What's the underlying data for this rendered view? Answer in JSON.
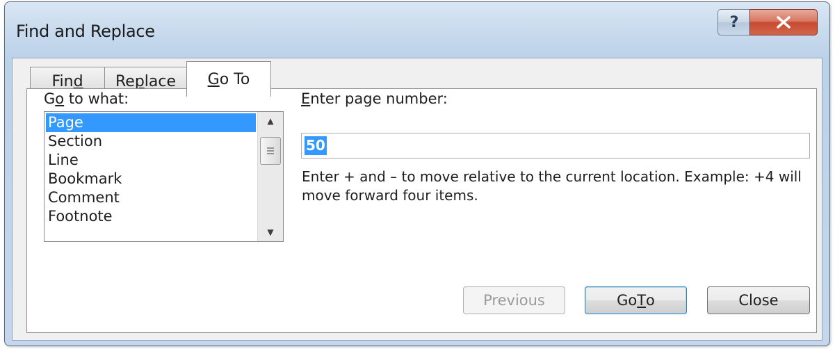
{
  "window": {
    "title": "Find and Replace"
  },
  "title_buttons": {
    "help_glyph": "?",
    "close_glyph": "✕"
  },
  "tabs": [
    {
      "label": "Find",
      "accel": "d",
      "active": false
    },
    {
      "label": "Replace",
      "accel": "p",
      "active": false
    },
    {
      "label": "Go To",
      "accel": "G",
      "active": true
    }
  ],
  "goto": {
    "what_label_pre": "G",
    "what_label_accel": "o",
    "what_label_post": " to what:",
    "items": [
      "Page",
      "Section",
      "Line",
      "Bookmark",
      "Comment",
      "Footnote"
    ],
    "selected_index": 0,
    "page_label_accel": "E",
    "page_label_rest": "nter page number:",
    "page_value": "50",
    "hint": "Enter + and – to move relative to the current location. Example: +4 will move forward four items."
  },
  "buttons": {
    "previous": "Previous",
    "goto_pre": "Go ",
    "goto_accel": "T",
    "goto_post": "o",
    "close": "Close"
  },
  "icons": {
    "scroll_up": "up-arrow",
    "scroll_down": "down-arrow",
    "scroll_grip": "grip"
  },
  "colors": {
    "selection": "#3399ff",
    "title_close": "#c74a30"
  }
}
